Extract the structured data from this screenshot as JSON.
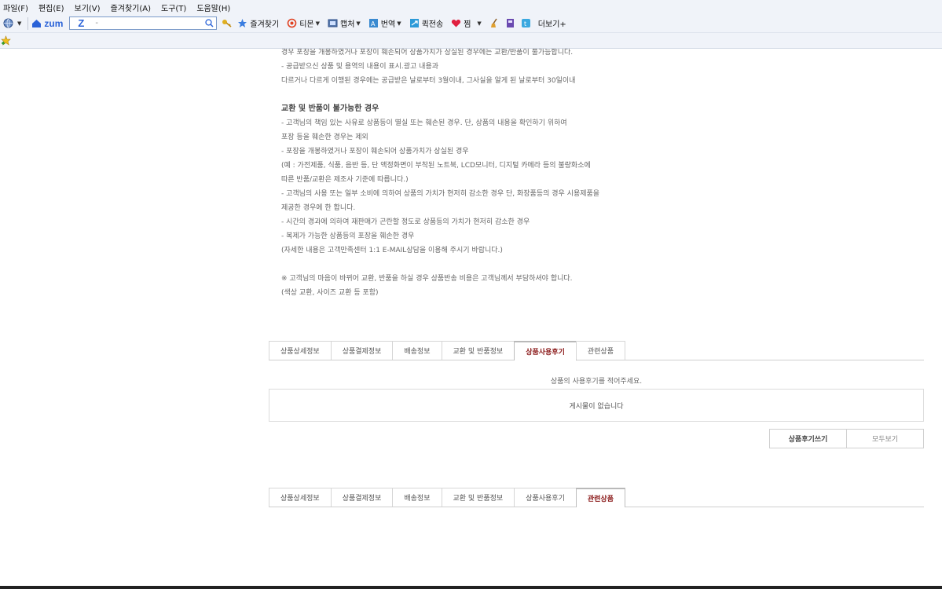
{
  "menu": [
    "파일(F)",
    "편집(E)",
    "보기(V)",
    "즐겨찾기(A)",
    "도구(T)",
    "도움말(H)"
  ],
  "toolbar": {
    "zum_label": "zum",
    "search_logo": "Z",
    "search_value": "-",
    "favorites": "즐겨찾기",
    "tistory": "티몬",
    "capture": "캡처",
    "translate": "번역",
    "quick_send": "퀵전송",
    "jjim": "찜",
    "more": "더보기+"
  },
  "notice": {
    "lines_top": [
      "경우 포장을 개봉하였거나 포장이 훼손되어 상품가치가 상실된 경우에는 교환/반품이 불가능합니다.",
      "- 공급받으신 상품 및 용역의 내용이 표시.광고 내용과",
      "  다르거나 다르게 이행된 경우에는 공급받은 날로부터 3월이내, 그사실을 알게 된 날로부터 30일이내"
    ],
    "heading": "교환 및 반품이 불가능한 경우",
    "lines_main": [
      "- 고객님의 책임 있는 사유로 상품등이 멸실 또는 훼손된 경우. 단, 상품의 내용을 확인하기 위하여",
      "  포장 등을 훼손한 경우는 제외",
      "- 포장을 개봉하였거나 포장이 훼손되어 상품가치가 상실된 경우",
      "  (예 : 가전제품, 식품, 음반 등, 단 액정화면이 부착된 노트북, LCD모니터, 디지털 카메라 등의 불량화소에",
      "  따른 반품/교환은 제조사 기준에 따릅니다.)",
      "- 고객님의 사용 또는 일부 소비에 의하여 상품의 가치가 현저히 감소한 경우 단, 화장품등의 경우 시용제품을",
      "  제공한 경우에 한 합니다.",
      "- 시간의 경과에 의하여 재판매가 곤란할 정도로 상품등의 가치가 현저히 감소한 경우",
      "- 복제가 가능한 상품등의 포장을 훼손한 경우",
      "  (자세한 내용은 고객만족센터 1:1 E-MAIL상담을 이용해 주시기 바랍니다.)"
    ],
    "lines_note": [
      "※ 고객님의 마음이 바뀌어 교환, 반품을 하실 경우 상품반송 비용은 고객님께서 부담하셔야 합니다.",
      "  (색상 교환, 사이즈 교환 등 포함)"
    ]
  },
  "tabs1": [
    {
      "label": "상품상세정보",
      "active": false
    },
    {
      "label": "상품결제정보",
      "active": false
    },
    {
      "label": "배송정보",
      "active": false
    },
    {
      "label": "교환 및 반품정보",
      "active": false
    },
    {
      "label": "상품사용후기",
      "active": true
    },
    {
      "label": "관련상품",
      "active": false
    }
  ],
  "tabs2": [
    {
      "label": "상품상세정보",
      "active": false
    },
    {
      "label": "상품결제정보",
      "active": false
    },
    {
      "label": "배송정보",
      "active": false
    },
    {
      "label": "교환 및 반품정보",
      "active": false
    },
    {
      "label": "상품사용후기",
      "active": false
    },
    {
      "label": "관련상품",
      "active": true
    }
  ],
  "review": {
    "prompt": "상품의 사용후기를 적어주세요.",
    "empty": "게시물이 없습니다",
    "write_button": "상품후기쓰기",
    "all_button": "모두보기"
  },
  "colors": {
    "active_tab": "#8b1a1a",
    "chrome_bg": "#f0f3f9",
    "accent": "#2b63d8"
  }
}
